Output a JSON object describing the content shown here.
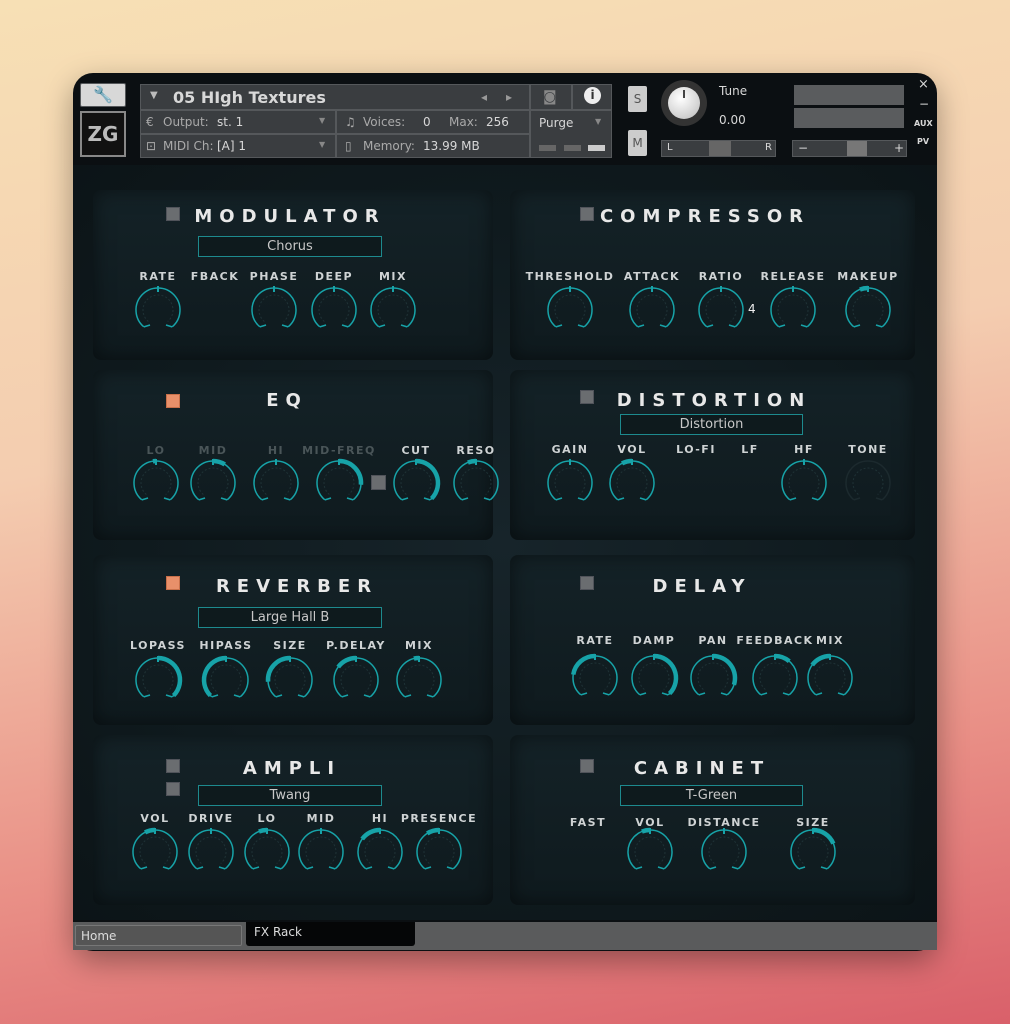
{
  "header": {
    "instrument_name": "05 HIgh Textures",
    "output_label": "Output:",
    "output_value": "st. 1",
    "midi_label": "MIDI Ch:",
    "midi_value": "[A]  1",
    "voices_label": "Voices:",
    "voices_value": "0",
    "max_label": "Max:",
    "max_value": "256",
    "memory_label": "Memory:",
    "memory_value": "13.99 MB",
    "purge_label": "Purge",
    "logo": "ZG",
    "solo_label": "S",
    "mute_label": "M",
    "tune_label": "Tune",
    "tune_value": "0.00",
    "pan_left": "L",
    "pan_right": "R",
    "vol_minus": "−",
    "vol_plus": "+",
    "close": "×",
    "minimize": "−",
    "aux": "AUX",
    "pv": "PV"
  },
  "modules": [
    {
      "id": "modulator",
      "title": "MODULATOR",
      "enabled": false,
      "selector": "Chorus",
      "knobs": [
        {
          "label": "RATE",
          "value": 0.5
        },
        {
          "label": "FBACK",
          "value": null
        },
        {
          "label": "PHASE",
          "value": 0.5
        },
        {
          "label": "DEEP",
          "value": 0.5
        },
        {
          "label": "MIX",
          "value": 0.5
        }
      ]
    },
    {
      "id": "compressor",
      "title": "COMPRESSOR",
      "enabled": false,
      "ratio_readout": "4",
      "knobs": [
        {
          "label": "THRESHOLD",
          "value": 0.5
        },
        {
          "label": "ATTACK",
          "value": 0.5
        },
        {
          "label": "RATIO",
          "value": 0.5
        },
        {
          "label": "RELEASE",
          "value": 0.5
        },
        {
          "label": "MAKEUP",
          "value": 0.42
        }
      ]
    },
    {
      "id": "eq",
      "title": "EQ",
      "enabled": true,
      "knobs": [
        {
          "label": "LO",
          "value": 0.47,
          "dim": true
        },
        {
          "label": "MID",
          "value": 0.62,
          "dim": true
        },
        {
          "label": "HI",
          "value": 0.5,
          "dim": true
        },
        {
          "label": "MID-FREQ",
          "value": 0.85,
          "dim": true
        },
        {
          "label": "CUT",
          "value": 1.0
        },
        {
          "label": "RESO",
          "value": 0.42
        }
      ]
    },
    {
      "id": "distortion",
      "title": "DISTORTION",
      "enabled": false,
      "selector": "Distortion",
      "knobs": [
        {
          "label": "GAIN",
          "value": 0.5
        },
        {
          "label": "VOL",
          "value": 0.4
        },
        {
          "label": "LO-FI",
          "value": null
        },
        {
          "label": "LF",
          "value": null
        },
        {
          "label": "HF",
          "value": 0.5
        },
        {
          "label": "TONE",
          "value": 0.5,
          "disabled": true
        }
      ]
    },
    {
      "id": "reverber",
      "title": "REVERBER",
      "enabled": true,
      "selector": "Large Hall B",
      "knobs": [
        {
          "label": "LOPASS",
          "value": 1.0
        },
        {
          "label": "HIPASS",
          "value": 0.0
        },
        {
          "label": "SIZE",
          "value": 0.15
        },
        {
          "label": "P.DELAY",
          "value": 0.3
        },
        {
          "label": "MIX",
          "value": 0.45
        }
      ]
    },
    {
      "id": "delay",
      "title": "DELAY",
      "enabled": false,
      "knobs": [
        {
          "label": "RATE",
          "value": 0.2
        },
        {
          "label": "DAMP",
          "value": 1.0
        },
        {
          "label": "PAN",
          "value": 0.9
        },
        {
          "label": "FEEDBACK",
          "value": 0.65
        },
        {
          "label": "MIX",
          "value": 0.3
        }
      ]
    },
    {
      "id": "ampli",
      "title": "AMPLI",
      "enabled": false,
      "selector": "Twang",
      "knobs": [
        {
          "label": "VOL",
          "value": 0.4
        },
        {
          "label": "DRIVE",
          "value": 0.5
        },
        {
          "label": "LO",
          "value": 0.42
        },
        {
          "label": "MID",
          "value": 0.5
        },
        {
          "label": "HI",
          "value": 0.3
        },
        {
          "label": "PRESENCE",
          "value": 0.38
        }
      ]
    },
    {
      "id": "cabinet",
      "title": "CABINET",
      "enabled": false,
      "selector": "T-Green",
      "knobs": [
        {
          "label": "FAST",
          "value": null
        },
        {
          "label": "VOL",
          "value": 0.42
        },
        {
          "label": "DISTANCE",
          "value": 0.5
        },
        {
          "label": "SIZE",
          "value": 0.75
        }
      ]
    }
  ],
  "tabs": [
    {
      "label": "Home",
      "active": false
    },
    {
      "label": "FX Rack",
      "active": true
    }
  ],
  "colors": {
    "accent": "#17a3a8",
    "toggle_on": "#e8906a",
    "toggle_off": "#6a6d70"
  }
}
